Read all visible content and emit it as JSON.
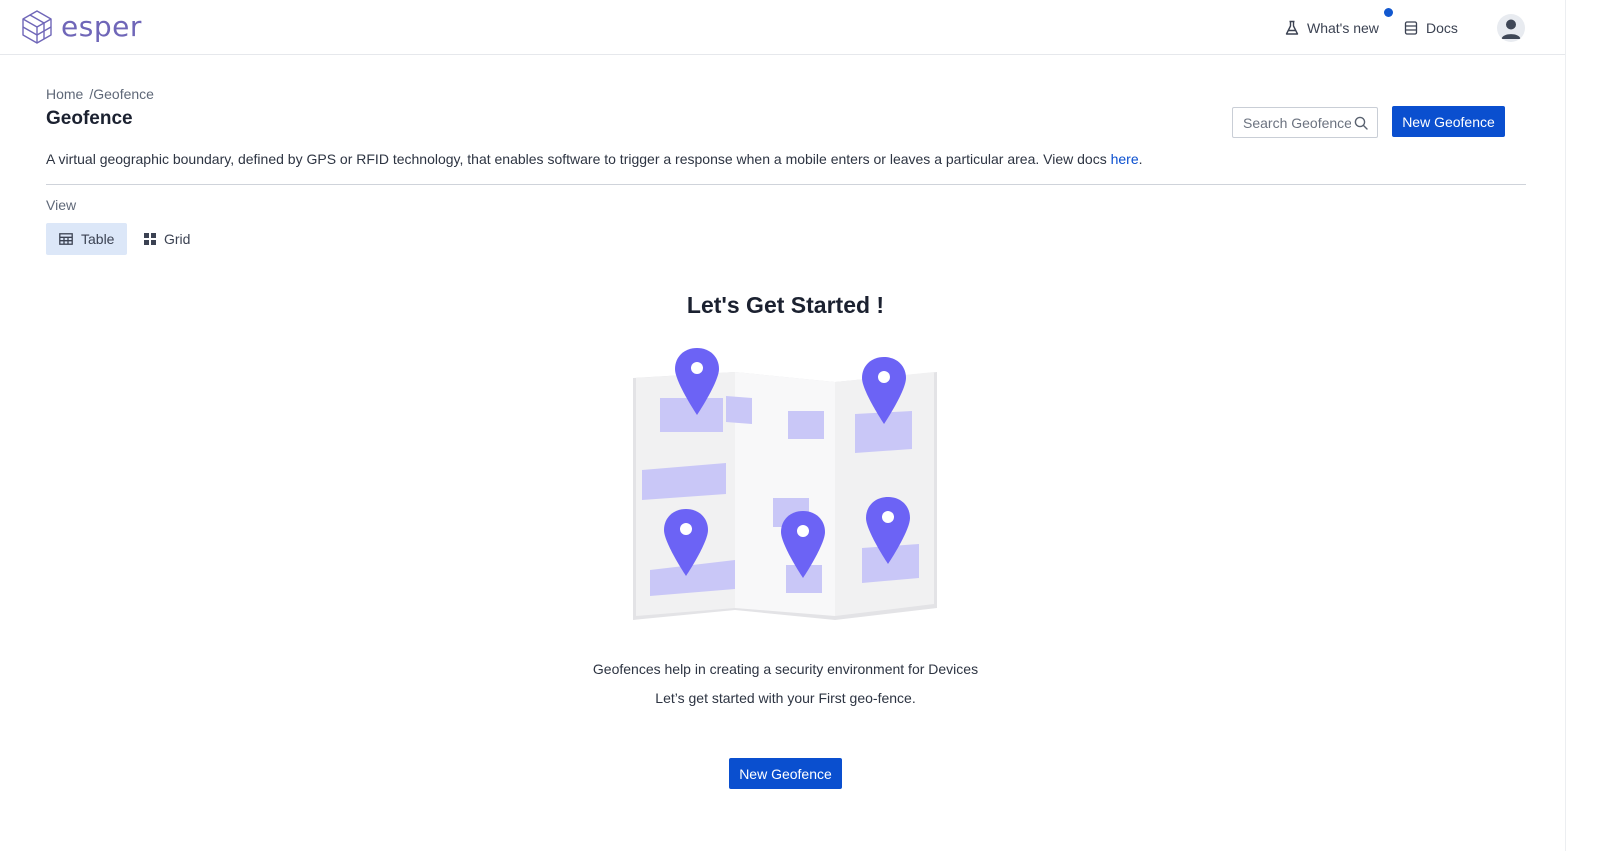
{
  "brand": {
    "name": "esper",
    "logo_color": "#6f66b8"
  },
  "topnav": {
    "whats_new": "What's new",
    "docs": "Docs",
    "notification_dot_color": "#1258cf"
  },
  "breadcrumb": {
    "home": "Home",
    "separator": "/",
    "current": "Geofence"
  },
  "page": {
    "title": "Geofence",
    "description": "A virtual geographic boundary, defined by GPS or RFID technology, that enables software to trigger a response when a mobile enters or leaves a particular area. View docs ",
    "docs_link": "here",
    "description_end": "."
  },
  "search": {
    "placeholder": "Search Geofence",
    "value": ""
  },
  "actions": {
    "new_geofence": "New Geofence"
  },
  "view": {
    "label": "View",
    "options": [
      {
        "label": "Table",
        "icon": "table-icon",
        "selected": true
      },
      {
        "label": "Grid",
        "icon": "grid-icon",
        "selected": false
      }
    ]
  },
  "empty_state": {
    "title": "Let's Get Started !",
    "line1": "Geofences help in creating a security environment for Devices",
    "line2": "Let’s get started with your First geo-fence.",
    "button": "New Geofence",
    "illustration": "map-with-location-pins",
    "pin_color": "#6c63f5",
    "zone_color": "#c9c7f7"
  },
  "colors": {
    "primary": "#0a4fcf",
    "selected_view_bg": "#dce7f8",
    "link": "#0a4fcf"
  }
}
